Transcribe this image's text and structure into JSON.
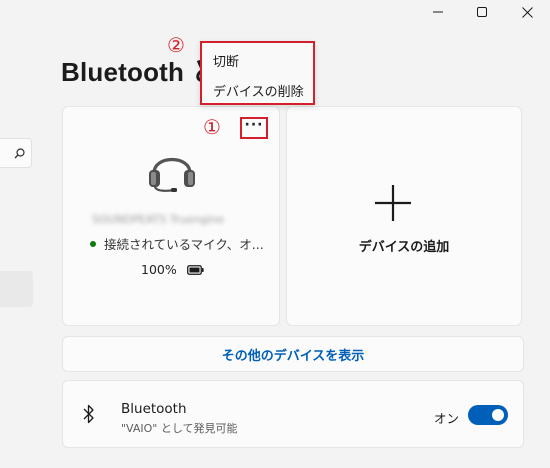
{
  "window": {
    "minimize_icon": "minimize-icon",
    "maximize_icon": "maximize-icon",
    "close_icon": "close-icon"
  },
  "sidebar": {
    "search_icon": "search-icon"
  },
  "page": {
    "title": "Bluetooth と"
  },
  "annotations": {
    "one": "①",
    "two": "②"
  },
  "context_menu": {
    "items": [
      {
        "label": "切断"
      },
      {
        "label": "デバイスの削除"
      }
    ]
  },
  "device_card": {
    "more_label": "···",
    "icon": "headset-icon",
    "name": "SOUNDPEATS Truengine",
    "status": "接続されているマイク、オ...",
    "battery": "100%",
    "battery_icon": "battery-icon",
    "status_color": "#0f7b0f"
  },
  "add_card": {
    "icon": "plus-icon",
    "label": "デバイスの追加"
  },
  "more_devices_link": "その他のデバイスを表示",
  "bluetooth_row": {
    "icon": "bluetooth-icon",
    "title": "Bluetooth",
    "subtitle": "\"VAIO\" として発見可能",
    "toggle_label": "オン",
    "toggle_on": true
  },
  "colors": {
    "accent": "#005fb8",
    "annotation": "#d3202c"
  }
}
